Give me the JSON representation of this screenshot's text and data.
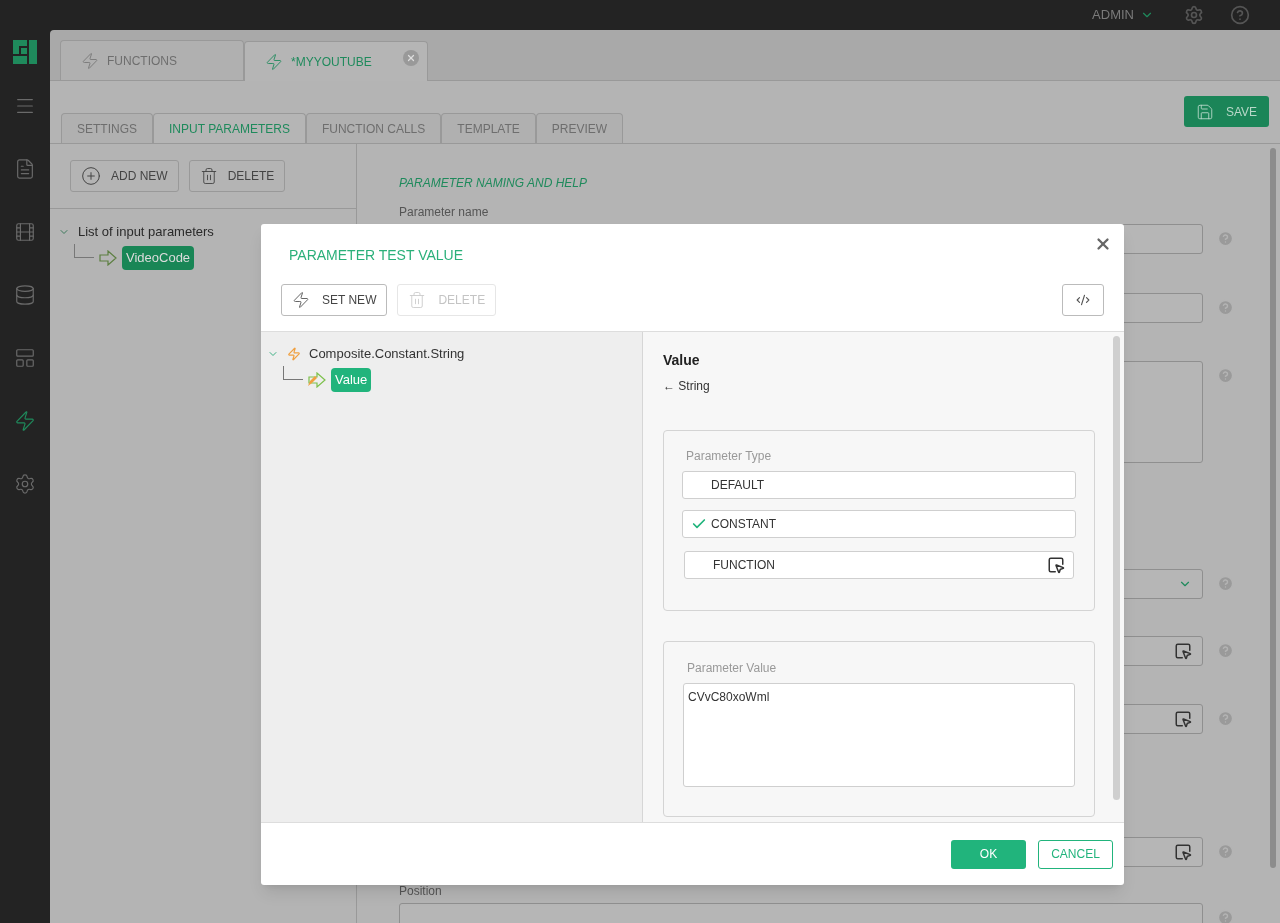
{
  "topbar": {
    "user": "ADMIN"
  },
  "nav": [
    {
      "selected": false
    },
    {
      "selected": false
    },
    {
      "selected": false
    },
    {
      "selected": false
    },
    {
      "selected": false
    },
    {
      "selected": true
    },
    {
      "selected": false
    }
  ],
  "doc_tabs": [
    {
      "label": "FUNCTIONS",
      "selected": false,
      "closable": false
    },
    {
      "label": "*MYYOUTUBE",
      "selected": true,
      "closable": true
    }
  ],
  "sub_tabs": [
    {
      "label": "SETTINGS",
      "selected": false
    },
    {
      "label": "INPUT PARAMETERS",
      "selected": true
    },
    {
      "label": "FUNCTION CALLS",
      "selected": false
    },
    {
      "label": "TEMPLATE",
      "selected": false
    },
    {
      "label": "PREVIEW",
      "selected": false
    }
  ],
  "save_button": "SAVE",
  "left_toolbar": [
    {
      "kind": "add",
      "label": "ADD NEW"
    },
    {
      "kind": "delete",
      "label": "DELETE"
    }
  ],
  "param_tree": {
    "label": "List of input parameters",
    "expanded": true,
    "children": [
      {
        "label": "VideoCode",
        "selected": true
      }
    ]
  },
  "section_title": "PARAMETER NAMING AND HELP",
  "form": [
    {
      "kind": "text",
      "label": "Parameter name"
    },
    {
      "kind": "text"
    },
    {
      "kind": "textarea"
    },
    {
      "kind": "select"
    },
    {
      "kind": "picker"
    },
    {
      "kind": "picker"
    },
    {
      "kind": "picker"
    },
    {
      "kind": "text",
      "label": "Position"
    }
  ],
  "modal": {
    "title": "PARAMETER TEST VALUE",
    "toolbar": [
      {
        "kind": "set",
        "label": "SET NEW",
        "disabled": false
      },
      {
        "kind": "delete",
        "label": "DELETE",
        "disabled": true
      }
    ],
    "tree": {
      "label": "Composite.Constant.String",
      "expanded": true,
      "children": [
        {
          "label": "Value",
          "selected": true
        }
      ]
    },
    "detail": {
      "name": "Value",
      "type": "← String"
    },
    "parameter_type": {
      "label": "Parameter Type",
      "options": [
        {
          "kind": "plain",
          "label": "DEFAULT",
          "selected": false
        },
        {
          "kind": "plain",
          "label": "CONSTANT",
          "selected": true
        },
        {
          "kind": "picker",
          "label": "FUNCTION",
          "selected": false
        }
      ]
    },
    "parameter_value": {
      "label": "Parameter Value",
      "value": "CVvC80xoWml"
    },
    "buttons": [
      {
        "kind": "primary",
        "label": "OK"
      },
      {
        "kind": "secondary",
        "label": "CANCEL"
      }
    ]
  }
}
